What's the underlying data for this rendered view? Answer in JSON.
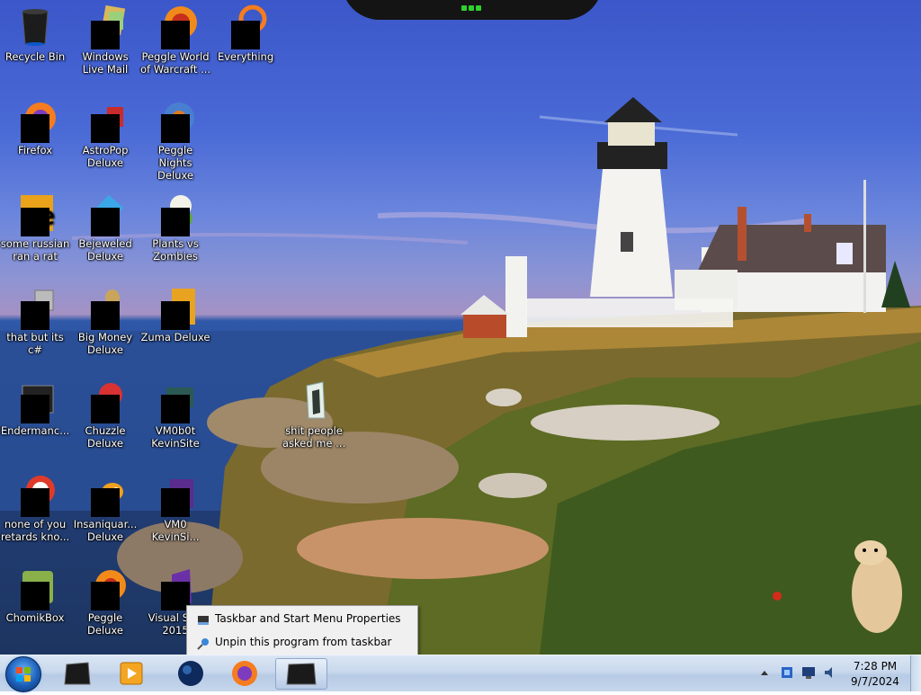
{
  "desktop": {
    "icons": [
      {
        "label": "Recycle Bin",
        "icon": "recycle-bin-icon"
      },
      {
        "label": "Windows Live Mail",
        "icon": "windows-live-mail-icon"
      },
      {
        "label": "Peggle World of Warcraft ...",
        "icon": "peggle-wow-icon"
      },
      {
        "label": "Everything",
        "icon": "everything-search-icon"
      },
      {
        "label": "Firefox",
        "icon": "firefox-icon"
      },
      {
        "label": "AstroPop Deluxe",
        "icon": "astropop-icon"
      },
      {
        "label": "Peggle Nights Deluxe",
        "icon": "peggle-nights-icon"
      },
      {
        "label": "some russian ran a rat",
        "icon": "program-icon"
      },
      {
        "label": "Bejeweled Deluxe",
        "icon": "bejeweled-icon"
      },
      {
        "label": "Plants vs Zombies",
        "icon": "plants-vs-zombies-icon"
      },
      {
        "label": "that but its c#",
        "icon": "shortcut-icon"
      },
      {
        "label": "Big Money Deluxe",
        "icon": "big-money-icon"
      },
      {
        "label": "Zuma Deluxe",
        "icon": "zuma-icon"
      },
      {
        "label": "Endermanc...",
        "icon": "program-icon"
      },
      {
        "label": "Chuzzle Deluxe",
        "icon": "chuzzle-icon"
      },
      {
        "label": "VM0b0t KevinSite",
        "icon": "vm-icon"
      },
      {
        "label": "shit people asked me ...",
        "icon": "folder-icon"
      },
      {
        "label": "none of you retards kno...",
        "icon": "program-icon"
      },
      {
        "label": "Insaniquar... Deluxe",
        "icon": "insaniquarium-icon"
      },
      {
        "label": "VM0 KevinSi...",
        "icon": "vm-icon"
      },
      {
        "label": "ChomikBox",
        "icon": "chomikbox-icon"
      },
      {
        "label": "Peggle Deluxe",
        "icon": "peggle-icon"
      },
      {
        "label": "Visual St... 2015",
        "icon": "visual-studio-icon"
      }
    ]
  },
  "context_menu": {
    "items": [
      {
        "label": "Taskbar and Start Menu Properties",
        "icon": "taskbar-icon"
      },
      {
        "label": "Unpin this program from taskbar",
        "icon": "unpin-icon"
      }
    ]
  },
  "taskbar": {
    "pinned": [
      {
        "name": "start-button",
        "icon": "windows-orb-icon"
      },
      {
        "name": "recycle-app",
        "icon": "app-icon"
      },
      {
        "name": "media-player",
        "icon": "media-player-icon"
      },
      {
        "name": "globe-app",
        "icon": "globe-icon"
      },
      {
        "name": "firefox",
        "icon": "firefox-icon"
      },
      {
        "name": "active-app",
        "icon": "app-icon"
      }
    ],
    "clock": {
      "time": "7:28 PM",
      "date": "9/7/2024"
    }
  }
}
